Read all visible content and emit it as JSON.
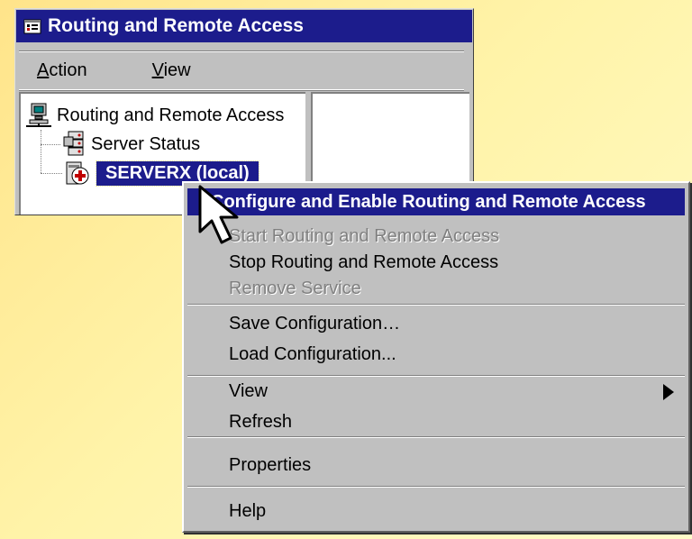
{
  "window": {
    "title": "Routing and Remote Access",
    "icon": "console-tree-icon"
  },
  "menubar": {
    "action": {
      "accel": "A",
      "rest": "ction"
    },
    "view": {
      "accel": "V",
      "rest": "iew"
    }
  },
  "tree": {
    "root_label": "Routing and Remote Access",
    "server_status_label": "Server Status",
    "server_label": "SERVERX (local)"
  },
  "context_menu": {
    "items": [
      {
        "label": "Configure and Enable Routing and Remote Access",
        "state": "highlighted"
      },
      {
        "label": "Start Routing and Remote Access",
        "state": "disabled"
      },
      {
        "label": "Stop Routing and Remote Access",
        "state": "enabled"
      },
      {
        "label": "Remove Service",
        "state": "disabled"
      },
      {
        "label": "Save Configuration…",
        "state": "enabled"
      },
      {
        "label": "Load Configuration...",
        "state": "enabled"
      },
      {
        "label": "View",
        "state": "enabled",
        "submenu": true
      },
      {
        "label": "Refresh",
        "state": "enabled"
      },
      {
        "label": "Properties",
        "state": "enabled"
      },
      {
        "label": "Help",
        "state": "enabled"
      }
    ]
  },
  "colors": {
    "titlebar": "#1c1c8c",
    "highlight": "#1c1c8c",
    "window_face": "#c0c0c0"
  }
}
